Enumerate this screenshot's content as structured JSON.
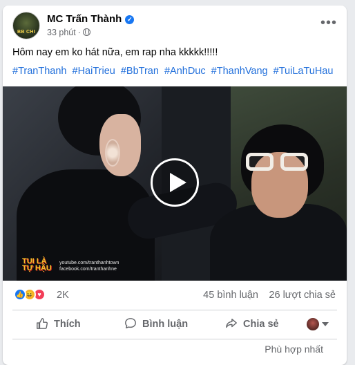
{
  "post": {
    "author": "MC Trấn Thành",
    "time": "33 phút",
    "separator": "·",
    "more_label": "•••",
    "avatar_text": "BB CHI",
    "text": "Hôm nay em ko hát nữa, em rap nha kkkkk!!!!!",
    "hashtags": [
      "#TranThanh",
      "#HaiTrieu",
      "#BbTran",
      "#AnhDuc",
      "#ThanhVang",
      "#TuiLaTuHau"
    ]
  },
  "video": {
    "watermark_logo_1": "TUI LÀ",
    "watermark_logo_2": "TỰ HẬU",
    "watermark_line_1": "youtube.com/tranthanhtown",
    "watermark_line_2": "facebook.com/tranthanhne"
  },
  "stats": {
    "reaction_count": "2K",
    "comments": "45 bình luận",
    "shares": "26 lượt chia sẻ",
    "reactions": [
      "like-icon",
      "haha-icon",
      "love-icon"
    ]
  },
  "actions": {
    "like": "Thích",
    "comment": "Bình luận",
    "share": "Chia sẻ"
  },
  "comments": {
    "sort_label": "Phù hợp nhất"
  },
  "colors": {
    "accent": "#1877f2",
    "hashtag": "#216fdb",
    "secondary_text": "#65676b",
    "love": "#f33e58",
    "haha": "#f7b125"
  }
}
